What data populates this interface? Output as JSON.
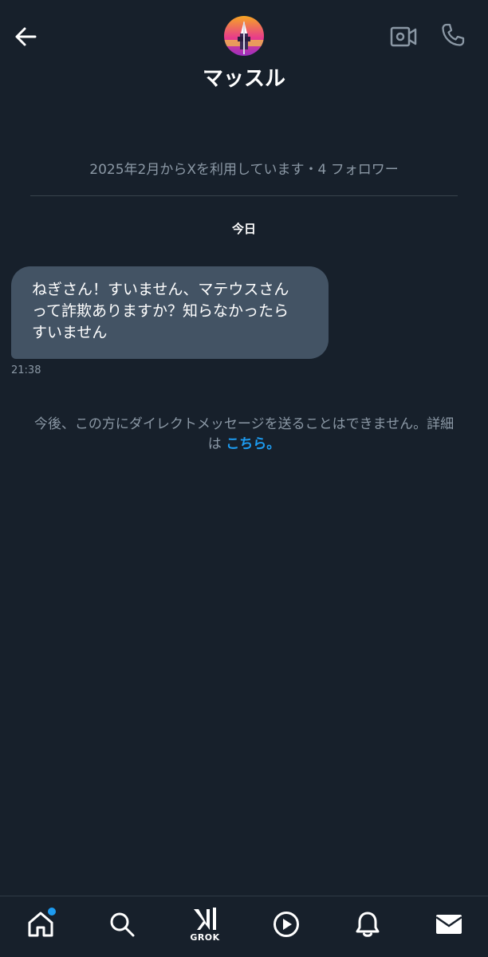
{
  "header": {
    "title": "マッスル",
    "back_icon": "arrow-left-icon",
    "video_icon": "video-call-icon",
    "call_icon": "phone-icon"
  },
  "profile": {
    "info": "2025年2月からXを利用しています・4 フォロワー"
  },
  "conversation": {
    "date_separator": "今日",
    "messages": [
      {
        "lines": [
          "ねぎさん！すいません、マテウスさん",
          "って詐欺ありますか？知らなかったら",
          "すいません"
        ],
        "time": "21:38"
      }
    ]
  },
  "notice": {
    "line1": "今後、この方にダイレクトメッセージを送ることはできません。詳細",
    "line2_prefix": "は",
    "link": "こちら。"
  },
  "bottom_nav": {
    "items": [
      {
        "icon": "home-icon",
        "has_dot": true
      },
      {
        "icon": "search-icon"
      },
      {
        "icon": "grok-icon",
        "label": "GROK"
      },
      {
        "icon": "play-icon"
      },
      {
        "icon": "bell-icon"
      },
      {
        "icon": "mail-icon"
      }
    ]
  },
  "colors": {
    "background": "#17202b",
    "bubble": "#435364",
    "muted_text": "#8b98a5",
    "link": "#1d9bf0",
    "notification_dot": "#1d9bf0"
  }
}
